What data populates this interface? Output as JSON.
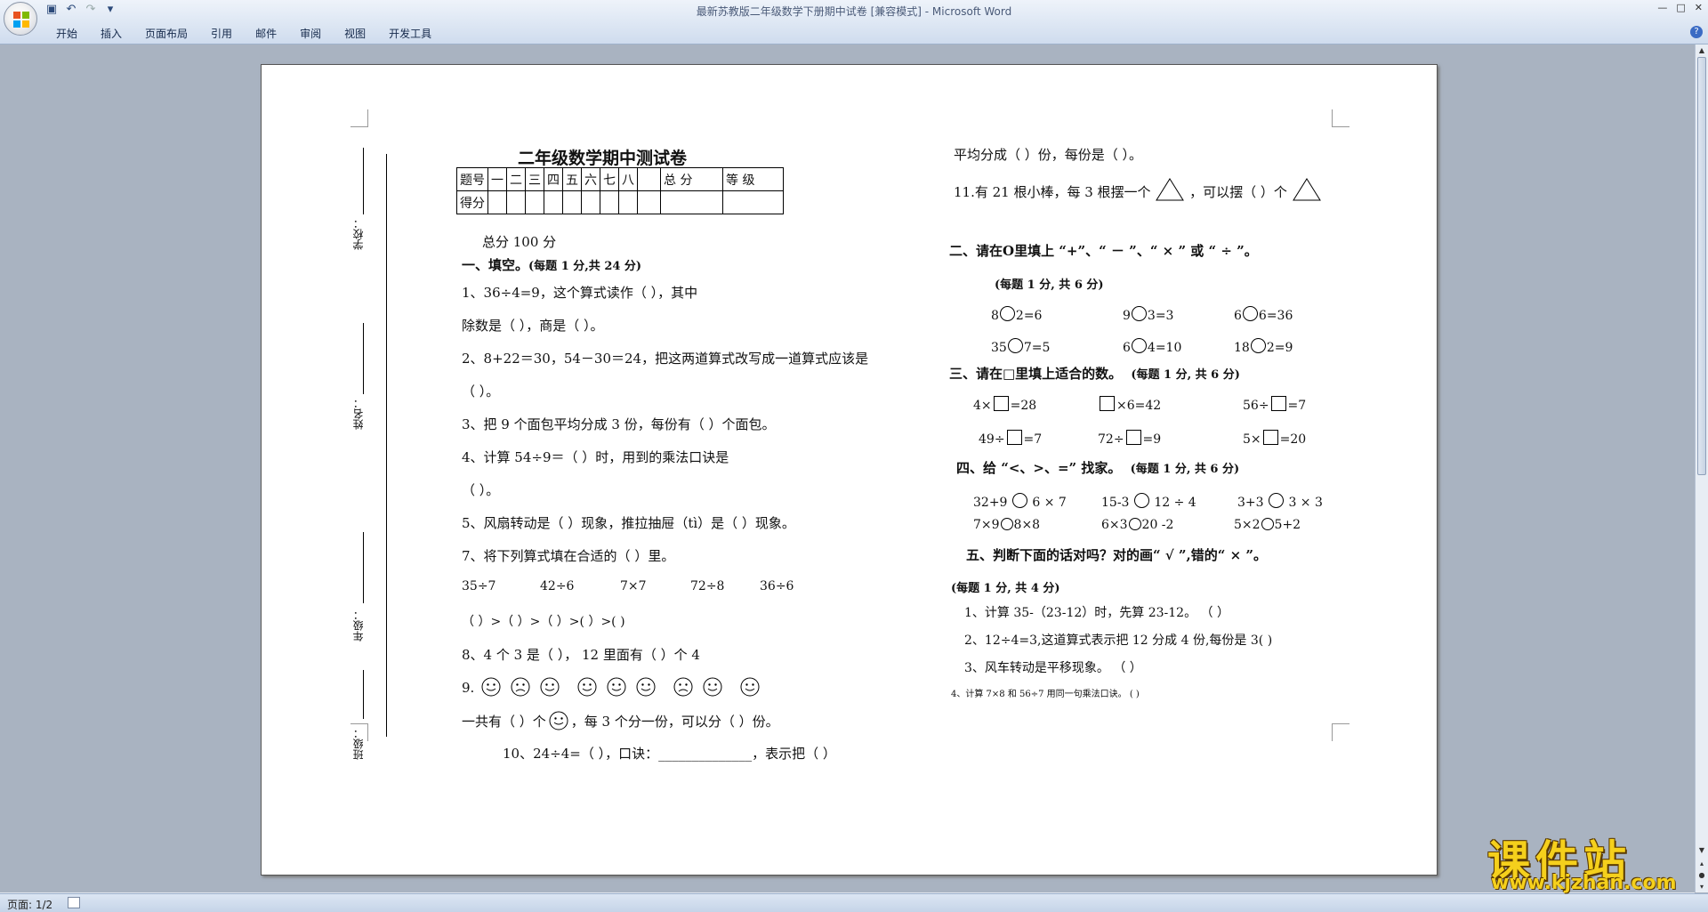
{
  "window": {
    "title": "最新苏教版二年级数学下册期中试卷 [兼容模式] - Microsoft Word",
    "controls": [
      "—",
      "□",
      "✕"
    ]
  },
  "ribbon": {
    "tabs": [
      "开始",
      "插入",
      "页面布局",
      "引用",
      "邮件",
      "审阅",
      "视图",
      "开发工具"
    ],
    "help": "?"
  },
  "side_labels": {
    "school": "学校：",
    "name": "姓名：",
    "grade": "年级：",
    "class": "班级："
  },
  "doc": {
    "title": "二年级数学期中测试卷",
    "score_table": {
      "row1": [
        "题号",
        "一",
        "二",
        "三",
        "四",
        "五",
        "六",
        "七",
        "八",
        "",
        "总  分",
        "等  级"
      ],
      "row2": [
        "得分",
        "",
        "",
        "",
        "",
        "",
        "",
        "",
        "",
        "",
        "",
        ""
      ]
    },
    "total": "总分 100 分",
    "sec1_title": "一、填空。",
    "sec1_note": "(每题 1 分,共 24 分)",
    "q1a": "1、36÷4=9，这个算式读作（                           ），其中",
    "q1b": "除数是（        ），商是（          ）。",
    "q2a": "2、8+22＝30，54－30＝24，把这两道算式改写成一道算式应该是",
    "q2b": "（                                       ）。",
    "q3": "3、把 9 个面包平均分成 3 份，每份有（     ）个面包。",
    "q4a": "4、计算  54÷9＝（          ）时，用到的乘法口诀是",
    "q4b": "（                                         ）。",
    "q5": "5、风扇转动是（       ）现象，推拉抽屉（tì）是（       ）现象。",
    "q7": "7、将下列算式填在合适的（    ）里。",
    "q7_exprs": [
      "35÷7",
      "42÷6",
      "7×7",
      "72÷8",
      "36÷6"
    ],
    "q7_blanks": "（          ）>（           ）>（           ）>(           ）>(          )",
    "q8": "8、4 个 3 是（        ），  12 里面有（       ）个 4",
    "q9_prefix": "9.",
    "q9b_a": "一共有（       ）个",
    "q9b_b": "，每 3 个分一份，可以分（      ）份。",
    "q10": "10、24÷4=（      ），口诀：______________，表示把（       ）",
    "q10_cont": "平均分成（          ）份，每份是（          ）。",
    "q11_a": "11.有 21 根小棒，每 3 根摆一个",
    "q11_b": "，可以摆（      ）个",
    "sec2_title": "二、请在O里填上 “+”、“ － ”、“ × ” 或 “ ÷ ”。",
    "sec2_note": "(每题 1 分, 共 6 分)",
    "sec2_items": [
      {
        "a": "8",
        "b": "2=6"
      },
      {
        "a": "9",
        "b": "3=3"
      },
      {
        "a": "6",
        "b": "6=36"
      },
      {
        "a": "35",
        "b": "7=5"
      },
      {
        "a": "6",
        "b": "4=10"
      },
      {
        "a": "18",
        "b": "2=9"
      }
    ],
    "sec3_title": "三、请在□里填上适合的数。",
    "sec3_note": "(每题 1 分, 共 6 分)",
    "sec3_items": [
      {
        "a": "4×",
        "b": "=28"
      },
      {
        "a": "",
        "b": "×6=42"
      },
      {
        "a": "56÷",
        "b": "=7"
      },
      {
        "a": "49÷",
        "b": "=7"
      },
      {
        "a": "72÷",
        "b": "=9"
      },
      {
        "a": "5×",
        "b": "=20"
      }
    ],
    "sec4_title": "四、给 “<、>、=” 找家。",
    "sec4_note": "(每题 1 分, 共 6 分)",
    "sec4_items": [
      {
        "a": "32+9",
        "b": "6 × 7"
      },
      {
        "a": "15-3",
        "b": "12 ÷ 4"
      },
      {
        "a": "3+3",
        "b": "3 × 3"
      },
      {
        "a": "7×9",
        "b": "8×8"
      },
      {
        "a": "6×3",
        "b": "20 -2"
      },
      {
        "a": "5×2",
        "b": "5+2"
      }
    ],
    "sec5_title": "五、判断下面的话对吗？对的画“  √    ”,错的“    ×   ”。",
    "sec5_note": "(每题 1 分, 共 4 分)",
    "sec5_items": [
      "1、计算 35-（23-12）时，先算 23-12。                  （      ）",
      "2、12÷4=3,这道算式表示把 12 分成 4 份,每份是 3(       )",
      "3、风车转动是平移现象。                                （      ）",
      "4、计算 7×8 和 56÷7 用同一句乘法口诀。       (        )"
    ]
  },
  "status": {
    "page": "页面: 1/2"
  },
  "watermark": {
    "cn": "课件站",
    "url": "www.kjzhan.com"
  }
}
